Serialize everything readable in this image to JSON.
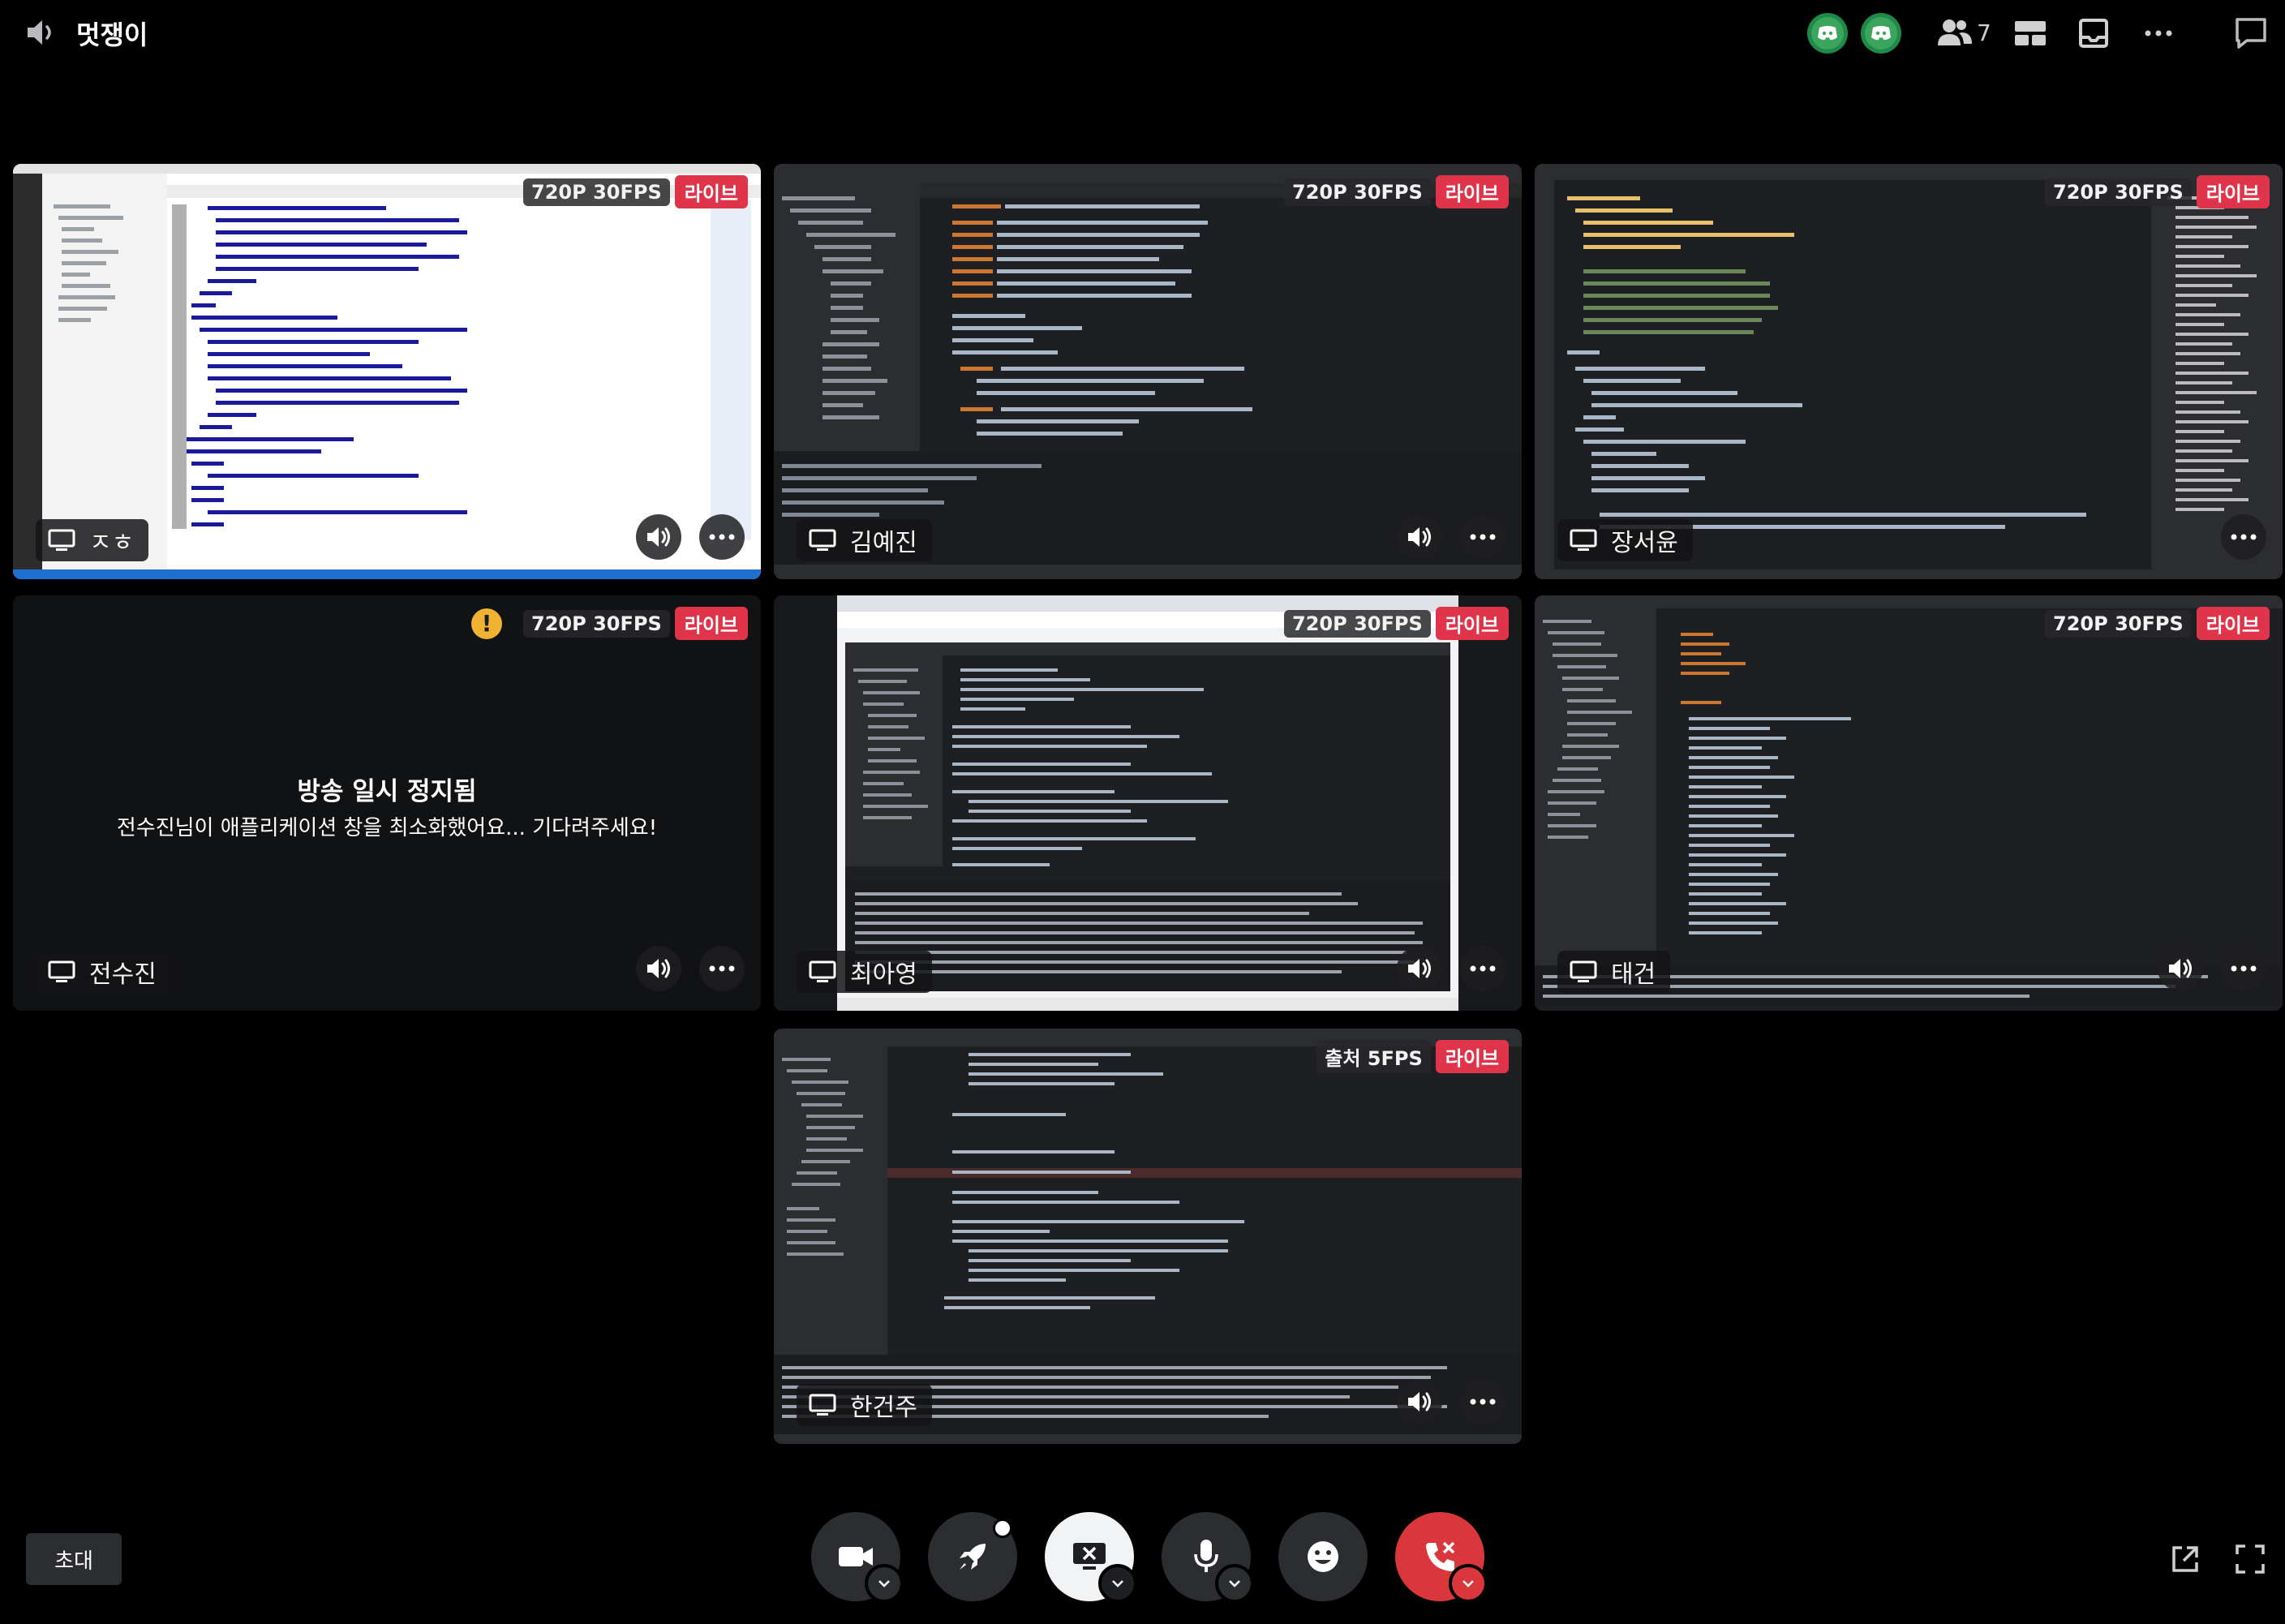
{
  "channel": {
    "name": "멋쟁이"
  },
  "participants": {
    "count": "7"
  },
  "tiles": [
    {
      "name": "ㅈㅎ",
      "quality": "720P 30FPS",
      "live": "라이브",
      "screen_style": "vscode"
    },
    {
      "name": "김예진",
      "quality": "720P 30FPS",
      "live": "라이브",
      "screen_style": "intellij"
    },
    {
      "name": "장서윤",
      "quality": "720P 30FPS",
      "live": "라이브",
      "screen_style": "vscode-dark"
    },
    {
      "name": "전수진",
      "quality": "720P 30FPS",
      "live": "라이브",
      "warning": "!",
      "paused_title": "방송 일시 정지됨",
      "paused_message": "전수진님이 애플리케이션 창을 최소화했어요... 기다려주세요!"
    },
    {
      "name": "최아영",
      "quality": "720P 30FPS",
      "live": "라이브",
      "screen_style": "browser-ide"
    },
    {
      "name": "태건",
      "quality": "720P 30FPS",
      "live": "라이브",
      "screen_style": "intellij-wide"
    },
    {
      "name": "한건주",
      "quality": "출처 5FPS",
      "live": "라이브",
      "screen_style": "intellij-light"
    }
  ],
  "bottom": {
    "invite_label": "초대"
  },
  "colors": {
    "live": "#e0344a",
    "end_call": "#da373c",
    "bot": "#3ba55d",
    "warning": "#f0b232"
  },
  "icons": [
    "speaker-icon",
    "discord-bot-icon",
    "people-icon",
    "layout-grid-icon",
    "inbox-icon",
    "more-icon",
    "chat-icon",
    "screen-share-icon",
    "camera-icon",
    "activity-rocket-icon",
    "stop-share-icon",
    "microphone-icon",
    "emoji-icon",
    "end-call-icon",
    "popout-icon",
    "fullscreen-icon"
  ]
}
